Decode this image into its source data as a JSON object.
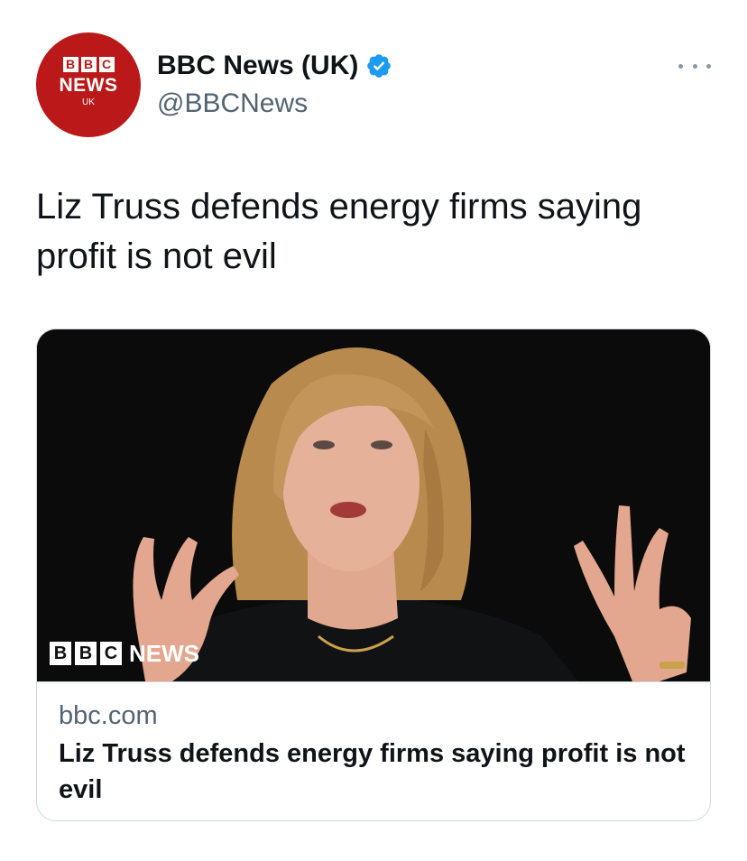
{
  "author": {
    "avatar": {
      "blocks": [
        "B",
        "B",
        "C"
      ],
      "news": "NEWS",
      "region": "UK"
    },
    "display_name": "BBC News (UK)",
    "handle": "@BBCNews",
    "verified": true
  },
  "tweet": {
    "text": "Liz Truss defends energy firms saying profit is not evil"
  },
  "card": {
    "image_logo": {
      "blocks": [
        "B",
        "B",
        "C"
      ],
      "news": "NEWS"
    },
    "domain": "bbc.com",
    "title": "Liz Truss defends energy firms saying profit is not evil"
  },
  "colors": {
    "brand_red": "#bb1919",
    "verified_blue": "#1d9bf0",
    "secondary_text": "#536471",
    "card_border": "#cfd9de"
  },
  "icons": {
    "verified": "verified-badge-icon",
    "more": "more-options-icon"
  }
}
